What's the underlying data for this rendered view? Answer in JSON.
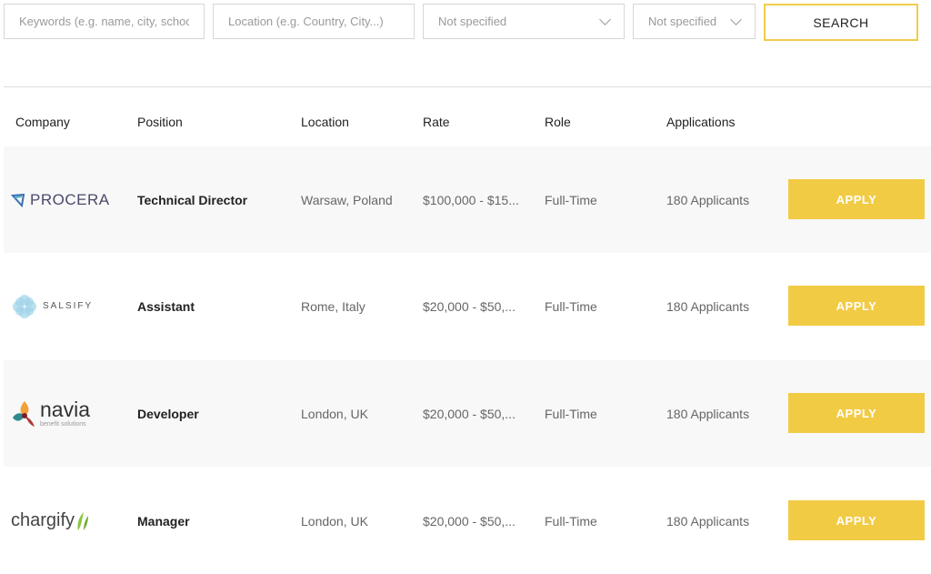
{
  "search": {
    "keywords_placeholder": "Keywords (e.g. name, city, schoo",
    "location_placeholder": "Location (e.g. Country, City...)",
    "select1_value": "Not specified",
    "select2_value": "Not specified",
    "search_label": "SEARCH"
  },
  "table": {
    "headers": [
      "Company",
      "Position",
      "Location",
      "Rate",
      "Role",
      "Applications"
    ],
    "rows": [
      {
        "company": "PROCERA",
        "position": "Technical Director",
        "location": "Warsaw, Poland",
        "rate": "$100,000 - $15...",
        "role": "Full-Time",
        "applications": "180 Applicants",
        "apply": "APPLY"
      },
      {
        "company": "SALSIFY",
        "position": "Assistant",
        "location": "Rome, Italy",
        "rate": "$20,000 - $50,...",
        "role": "Full-Time",
        "applications": "180 Applicants",
        "apply": "APPLY"
      },
      {
        "company": "navia",
        "company_tagline": "benefit solutions",
        "position": "Developer",
        "location": "London, UK",
        "rate": "$20,000 - $50,...",
        "role": "Full-Time",
        "applications": "180 Applicants",
        "apply": "APPLY"
      },
      {
        "company": "chargify",
        "position": "Manager",
        "location": "London, UK",
        "rate": "$20,000 - $50,...",
        "role": "Full-Time",
        "applications": "180 Applicants",
        "apply": "APPLY"
      }
    ]
  },
  "colors": {
    "accent": "#f2cb45",
    "row_shade": "#f8f8f8"
  }
}
